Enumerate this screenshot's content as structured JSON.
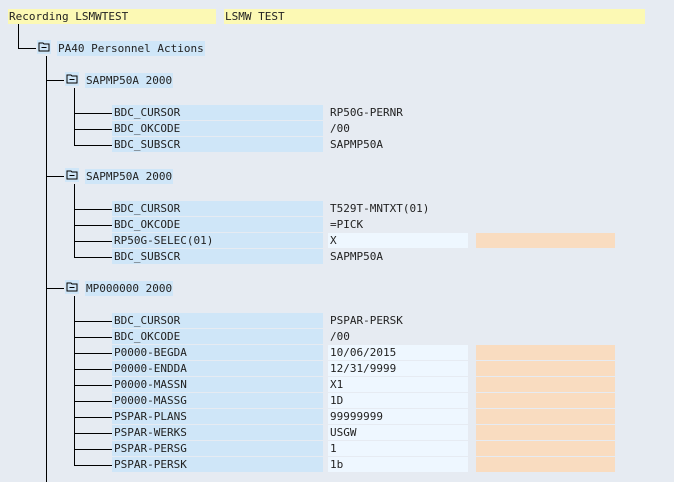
{
  "header": {
    "recording": "Recording LSMWTEST",
    "description": "LSMW TEST"
  },
  "transaction": {
    "label": "PA40 Personnel Actions",
    "icon": "folder-open-icon"
  },
  "screens": [
    {
      "label": "SAPMP50A 2000",
      "fields": [
        {
          "name": "BDC_CURSOR",
          "value": "RP50G-PERNR",
          "input": false
        },
        {
          "name": "BDC_OKCODE",
          "value": "/00",
          "input": false
        },
        {
          "name": "BDC_SUBSCR",
          "value": "SAPMP50A",
          "input": false
        }
      ]
    },
    {
      "label": "SAPMP50A 2000",
      "fields": [
        {
          "name": "BDC_CURSOR",
          "value": "T529T-MNTXT(01)",
          "input": false
        },
        {
          "name": "BDC_OKCODE",
          "value": "=PICK",
          "input": false
        },
        {
          "name": "RP50G-SELEC(01)",
          "value": "X",
          "input": true
        },
        {
          "name": "BDC_SUBSCR",
          "value": "SAPMP50A",
          "input": false
        }
      ]
    },
    {
      "label": "MP000000 2000",
      "fields": [
        {
          "name": "BDC_CURSOR",
          "value": "PSPAR-PERSK",
          "input": false
        },
        {
          "name": "BDC_OKCODE",
          "value": "/00",
          "input": false
        },
        {
          "name": "P0000-BEGDA",
          "value": "10/06/2015",
          "input": true
        },
        {
          "name": "P0000-ENDDA",
          "value": "12/31/9999",
          "input": true
        },
        {
          "name": "P0000-MASSN",
          "value": "X1",
          "input": true
        },
        {
          "name": "P0000-MASSG",
          "value": "1D",
          "input": true
        },
        {
          "name": "PSPAR-PLANS",
          "value": "99999999",
          "input": true
        },
        {
          "name": "PSPAR-WERKS",
          "value": "USGW",
          "input": true
        },
        {
          "name": "PSPAR-PERSG",
          "value": "1",
          "input": true
        },
        {
          "name": "PSPAR-PERSK",
          "value": "1b",
          "input": true
        }
      ]
    }
  ]
}
